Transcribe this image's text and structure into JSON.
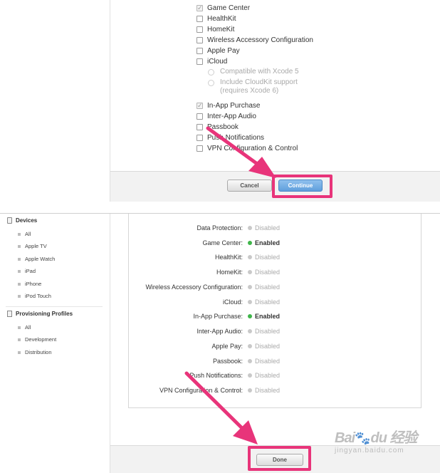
{
  "capabilities_top": [
    {
      "label": "Game Center",
      "checked": true
    },
    {
      "label": "HealthKit",
      "checked": false
    },
    {
      "label": "HomeKit",
      "checked": false
    },
    {
      "label": "Wireless Accessory Configuration",
      "checked": false
    },
    {
      "label": "Apple Pay",
      "checked": false
    },
    {
      "label": "iCloud",
      "checked": false
    },
    {
      "label": "In-App Purchase",
      "checked": true
    },
    {
      "label": "Inter-App Audio",
      "checked": false
    },
    {
      "label": "Passbook",
      "checked": false
    },
    {
      "label": "Push Notifications",
      "checked": false
    },
    {
      "label": "VPN Configuration & Control",
      "checked": false
    }
  ],
  "icloud_options": [
    {
      "line1": "Compatible with Xcode 5",
      "line2": ""
    },
    {
      "line1": "Include CloudKit support",
      "line2": "(requires Xcode 6)"
    }
  ],
  "top_footer": {
    "cancel": "Cancel",
    "continue": "Continue"
  },
  "sidebar": {
    "devices": {
      "title": "Devices",
      "items": [
        "All",
        "Apple TV",
        "Apple Watch",
        "iPad",
        "iPhone",
        "iPod Touch"
      ]
    },
    "profiles": {
      "title": "Provisioning Profiles",
      "items": [
        "All",
        "Development",
        "Distribution"
      ]
    }
  },
  "summary": [
    {
      "label": "Data Protection:",
      "status": "Disabled",
      "enabled": false
    },
    {
      "label": "Game Center:",
      "status": "Enabled",
      "enabled": true
    },
    {
      "label": "HealthKit:",
      "status": "Disabled",
      "enabled": false
    },
    {
      "label": "HomeKit:",
      "status": "Disabled",
      "enabled": false
    },
    {
      "label": "Wireless Accessory Configuration:",
      "status": "Disabled",
      "enabled": false
    },
    {
      "label": "iCloud:",
      "status": "Disabled",
      "enabled": false
    },
    {
      "label": "In-App Purchase:",
      "status": "Enabled",
      "enabled": true
    },
    {
      "label": "Inter-App Audio:",
      "status": "Disabled",
      "enabled": false
    },
    {
      "label": "Apple Pay:",
      "status": "Disabled",
      "enabled": false
    },
    {
      "label": "Passbook:",
      "status": "Disabled",
      "enabled": false
    },
    {
      "label": "Push Notifications:",
      "status": "Disabled",
      "enabled": false
    },
    {
      "label": "VPN Configuration & Control:",
      "status": "Disabled",
      "enabled": false
    }
  ],
  "bottom_footer": {
    "done": "Done"
  },
  "watermark": {
    "brand": "Bai",
    "brand2": "du",
    "suffix": "经验",
    "url": "jingyan.baidu.com"
  },
  "colors": {
    "highlight": "#e8347a",
    "enabled_dot": "#3fb54a",
    "disabled_dot": "#c9c9c9",
    "continue_blue": "#6aa8e2"
  },
  "icons": {
    "checkbox": "checkbox-icon",
    "radio": "radio-icon",
    "device": "device-icon",
    "profile": "document-icon",
    "arrow": "pointer-arrow-icon"
  }
}
